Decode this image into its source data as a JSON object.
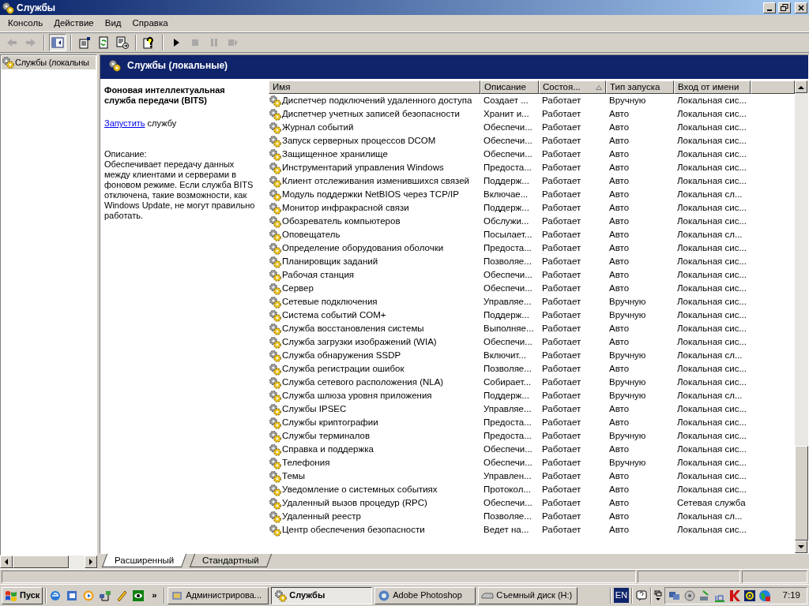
{
  "window": {
    "title": "Службы"
  },
  "menu": [
    "Консоль",
    "Действие",
    "Вид",
    "Справка"
  ],
  "toolbar": [
    {
      "kind": "back",
      "disabled": true
    },
    {
      "kind": "forward",
      "disabled": true
    },
    {
      "kind": "separator"
    },
    {
      "kind": "tree",
      "disabled": false
    },
    {
      "kind": "separator"
    },
    {
      "kind": "properties",
      "disabled": false
    },
    {
      "kind": "refresh",
      "disabled": false
    },
    {
      "kind": "export",
      "disabled": false
    },
    {
      "kind": "separator"
    },
    {
      "kind": "help",
      "disabled": false
    },
    {
      "kind": "separator"
    },
    {
      "kind": "start",
      "disabled": false
    },
    {
      "kind": "stop",
      "disabled": true
    },
    {
      "kind": "pause",
      "disabled": true
    },
    {
      "kind": "restart",
      "disabled": true
    }
  ],
  "tree": {
    "items": [
      {
        "label": "Службы (локальны",
        "selected": true
      }
    ]
  },
  "header": {
    "title": "Службы (локальные)"
  },
  "details": {
    "service_name": "Фоновая интеллектуальная служба передачи (BITS)",
    "action_link": "Запустить",
    "action_text": "службу",
    "description_label": "Описание:",
    "description": "Обеспечивает передачу данных между клиентами и серверами в фоновом режиме. Если служба BITS отключена, такие возможности, как Windows Update, не могут правильно работать."
  },
  "table": {
    "columns": [
      {
        "label": "Имя",
        "sorted": false
      },
      {
        "label": "Описание",
        "sorted": false
      },
      {
        "label": "Состоя...",
        "sorted": true
      },
      {
        "label": "Тип запуска",
        "sorted": false
      },
      {
        "label": "Вход от имени",
        "sorted": false
      }
    ],
    "rows": [
      [
        "Диспетчер подключений удаленного доступа",
        "Создает ...",
        "Работает",
        "Вручную",
        "Локальная сис..."
      ],
      [
        "Диспетчер учетных записей безопасности",
        "Хранит и...",
        "Работает",
        "Авто",
        "Локальная сис..."
      ],
      [
        "Журнал событий",
        "Обеспечи...",
        "Работает",
        "Авто",
        "Локальная сис..."
      ],
      [
        "Запуск серверных процессов DCOM",
        "Обеспечи...",
        "Работает",
        "Авто",
        "Локальная сис..."
      ],
      [
        "Защищенное хранилище",
        "Обеспечи...",
        "Работает",
        "Авто",
        "Локальная сис..."
      ],
      [
        "Инструментарий управления Windows",
        "Предоста...",
        "Работает",
        "Авто",
        "Локальная сис..."
      ],
      [
        "Клиент отслеживания изменившихся связей",
        "Поддерж...",
        "Работает",
        "Авто",
        "Локальная сис..."
      ],
      [
        "Модуль поддержки NetBIOS через TCP/IP",
        "Включае...",
        "Работает",
        "Авто",
        "Локальная сл..."
      ],
      [
        "Монитор инфракрасной связи",
        "Поддерж...",
        "Работает",
        "Авто",
        "Локальная сис..."
      ],
      [
        "Обозреватель компьютеров",
        "Обслужи...",
        "Работает",
        "Авто",
        "Локальная сис..."
      ],
      [
        "Оповещатель",
        "Посылает...",
        "Работает",
        "Авто",
        "Локальная сл..."
      ],
      [
        "Определение оборудования оболочки",
        "Предоста...",
        "Работает",
        "Авто",
        "Локальная сис..."
      ],
      [
        "Планировщик заданий",
        "Позволяе...",
        "Работает",
        "Авто",
        "Локальная сис..."
      ],
      [
        "Рабочая станция",
        "Обеспечи...",
        "Работает",
        "Авто",
        "Локальная сис..."
      ],
      [
        "Сервер",
        "Обеспечи...",
        "Работает",
        "Авто",
        "Локальная сис..."
      ],
      [
        "Сетевые подключения",
        "Управляе...",
        "Работает",
        "Вручную",
        "Локальная сис..."
      ],
      [
        "Система событий COM+",
        "Поддерж...",
        "Работает",
        "Вручную",
        "Локальная сис..."
      ],
      [
        "Служба восстановления системы",
        "Выполняе...",
        "Работает",
        "Авто",
        "Локальная сис..."
      ],
      [
        "Служба загрузки изображений (WIA)",
        "Обеспечи...",
        "Работает",
        "Авто",
        "Локальная сис..."
      ],
      [
        "Служба обнаружения SSDP",
        "Включит...",
        "Работает",
        "Вручную",
        "Локальная сл..."
      ],
      [
        "Служба регистрации ошибок",
        "Позволяе...",
        "Работает",
        "Авто",
        "Локальная сис..."
      ],
      [
        "Служба сетевого расположения (NLA)",
        "Собирает...",
        "Работает",
        "Вручную",
        "Локальная сис..."
      ],
      [
        "Служба шлюза уровня приложения",
        "Поддерж...",
        "Работает",
        "Вручную",
        "Локальная сл..."
      ],
      [
        "Службы IPSEC",
        "Управляе...",
        "Работает",
        "Авто",
        "Локальная сис..."
      ],
      [
        "Службы криптографии",
        "Предоста...",
        "Работает",
        "Авто",
        "Локальная сис..."
      ],
      [
        "Службы терминалов",
        "Предоста...",
        "Работает",
        "Вручную",
        "Локальная сис..."
      ],
      [
        "Справка и поддержка",
        "Обеспечи...",
        "Работает",
        "Авто",
        "Локальная сис..."
      ],
      [
        "Телефония",
        "Обеспечи...",
        "Работает",
        "Вручную",
        "Локальная сис..."
      ],
      [
        "Темы",
        "Управлен...",
        "Работает",
        "Авто",
        "Локальная сис..."
      ],
      [
        "Уведомление о системных событиях",
        "Протокол...",
        "Работает",
        "Авто",
        "Локальная сис..."
      ],
      [
        "Удаленный вызов процедур (RPC)",
        "Обеспечи...",
        "Работает",
        "Авто",
        "Сетевая служба"
      ],
      [
        "Удаленный реестр",
        "Позволяе...",
        "Работает",
        "Авто",
        "Локальная сл..."
      ],
      [
        "Центр обеспечения безопасности",
        "Ведет на...",
        "Работает",
        "Авто",
        "Локальная сис..."
      ]
    ]
  },
  "view_tabs": [
    {
      "label": "Расширенный",
      "selected": true
    },
    {
      "label": "Стандартный",
      "selected": false
    }
  ],
  "taskbar": {
    "start": "Пуск",
    "quick_launch_more": "»",
    "buttons": [
      {
        "label": "Администрирова...",
        "selected": false
      },
      {
        "label": "Службы",
        "selected": true
      },
      {
        "label": "Adobe Photoshop",
        "selected": false
      },
      {
        "label": "Съемный диск (H:)",
        "selected": false
      }
    ],
    "language": "EN",
    "clock": "7:19"
  }
}
